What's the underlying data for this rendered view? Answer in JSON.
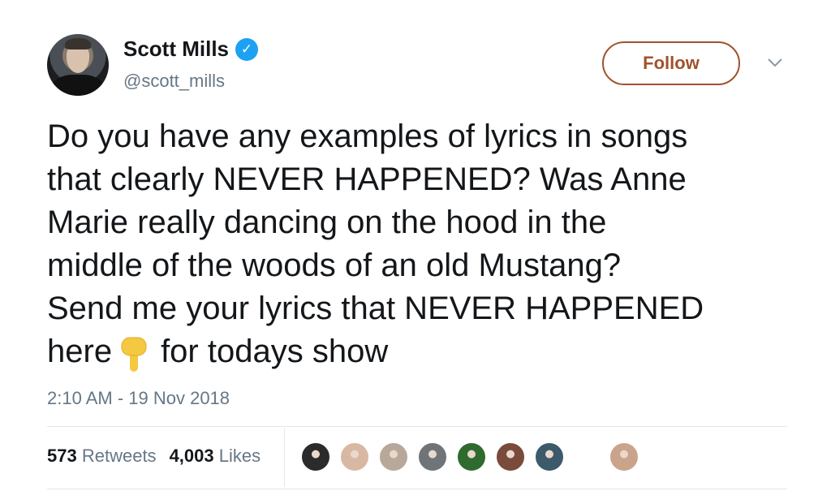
{
  "author": {
    "display_name": "Scott Mills",
    "handle": "@scott_mills",
    "verified": true
  },
  "actions": {
    "follow_label": "Follow"
  },
  "tweet": {
    "lines": [
      "Do you have any examples of lyrics in songs",
      "that clearly NEVER HAPPENED? Was Anne",
      "Marie really dancing on the hood in the",
      "middle of the woods of an old Mustang?",
      "Send me your lyrics that NEVER HAPPENED"
    ],
    "last_line_before_icon": "here",
    "last_line_after_icon": "for todays show",
    "inline_icon": "pointing-down-emoji-icon",
    "timestamp": "2:10 AM - 19 Nov 2018"
  },
  "stats": {
    "retweets_count": "573",
    "retweets_label": "Retweets",
    "likes_count": "4,003",
    "likes_label": "Likes"
  },
  "liker_avatars": [
    {
      "name": "liker-avatar-1",
      "color": "#2b2b2b"
    },
    {
      "name": "liker-avatar-2",
      "color": "#d9b8a3"
    },
    {
      "name": "liker-avatar-3",
      "color": "#b8a89a"
    },
    {
      "name": "liker-avatar-4",
      "color": "#6f7478"
    },
    {
      "name": "liker-avatar-5",
      "color": "#2f6b2f"
    },
    {
      "name": "liker-avatar-6",
      "color": "#7a4a3a"
    },
    {
      "name": "liker-avatar-7",
      "color": "#3d5a6b"
    },
    {
      "name": "liker-avatar-8",
      "color": "#c9a48a"
    }
  ],
  "colors": {
    "accent": "#a0522d",
    "verified": "#1da1f2",
    "secondary_text": "#657786",
    "primary_text": "#14171a"
  }
}
